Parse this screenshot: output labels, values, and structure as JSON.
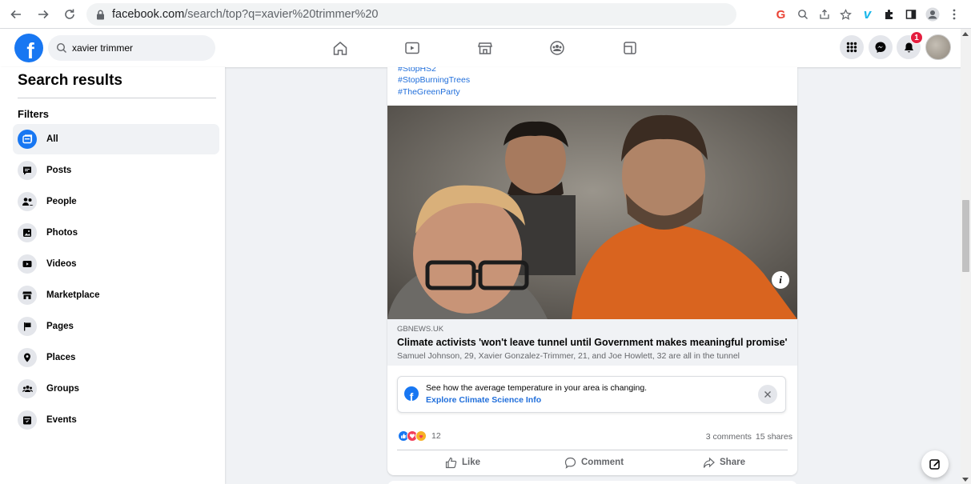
{
  "browser": {
    "url_host": "facebook.com",
    "url_path": "/search/top?q=xavier%20trimmer%20"
  },
  "fb_header": {
    "search_value": "xavier trimmer",
    "notification_count": "1"
  },
  "sidebar": {
    "title": "Search results",
    "filters_label": "Filters",
    "items": [
      {
        "label": "All",
        "icon": "feed-icon",
        "active": true
      },
      {
        "label": "Posts",
        "icon": "post-icon"
      },
      {
        "label": "People",
        "icon": "people-icon"
      },
      {
        "label": "Photos",
        "icon": "photos-icon"
      },
      {
        "label": "Videos",
        "icon": "videos-icon"
      },
      {
        "label": "Marketplace",
        "icon": "marketplace-icon"
      },
      {
        "label": "Pages",
        "icon": "flag-icon"
      },
      {
        "label": "Places",
        "icon": "location-pin-icon"
      },
      {
        "label": "Groups",
        "icon": "groups-icon"
      },
      {
        "label": "Events",
        "icon": "calendar-icon"
      }
    ]
  },
  "post": {
    "hashtags": [
      "#StopHS2",
      "#StopBurningTrees",
      "#TheGreenParty"
    ],
    "link": {
      "domain": "GBNEWS.UK",
      "title": "Climate activists 'won't leave tunnel until Government makes meaningful promise'",
      "description": "Samuel Johnson, 29, Xavier Gonzalez-Trimmer, 21, and Joe Howlett, 32 are all in the tunnel"
    },
    "climate_info": {
      "text": "See how the average temperature in your area is changing.",
      "link": "Explore Climate Science Info"
    },
    "reaction_count": "12",
    "comments": "3 comments",
    "shares": "15 shares",
    "actions": {
      "like": "Like",
      "comment": "Comment",
      "share": "Share"
    }
  },
  "colors": {
    "fb_blue": "#1877f2",
    "link_blue": "#216fdb",
    "badge_red": "#e41e3f"
  }
}
